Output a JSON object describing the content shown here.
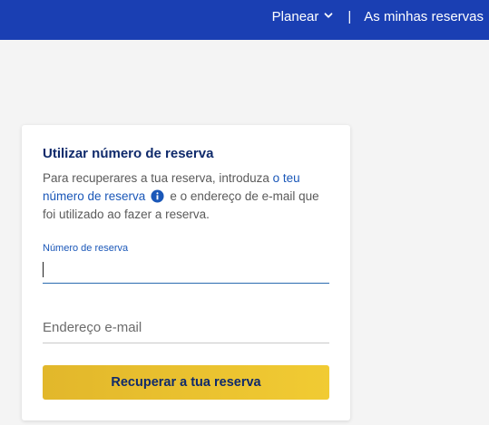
{
  "header": {
    "nav": {
      "plan_label": "Planear",
      "separator": "|",
      "my_bookings_label": "As minhas reservas"
    }
  },
  "booking_card": {
    "title": "Utilizar número de reserva",
    "description": {
      "part1": "Para recuperares a tua reserva, introduza ",
      "link": "o teu número de reserva",
      "part2": "e o endereço de e-mail que foi utilizado ao fazer a reserva."
    },
    "booking_number_field": {
      "label": "Número de reserva",
      "value": ""
    },
    "email_field": {
      "placeholder": "Endereço e-mail",
      "value": ""
    },
    "submit_label": "Recuperar a tua reserva"
  },
  "colors": {
    "header_bg": "#1a3fb3",
    "title_color": "#0f2a6b",
    "link_color": "#1a57b8",
    "button_gold": "#f1cb33"
  },
  "icons": {
    "plan_chevron": "chevron-down-icon",
    "info": "info-icon"
  }
}
